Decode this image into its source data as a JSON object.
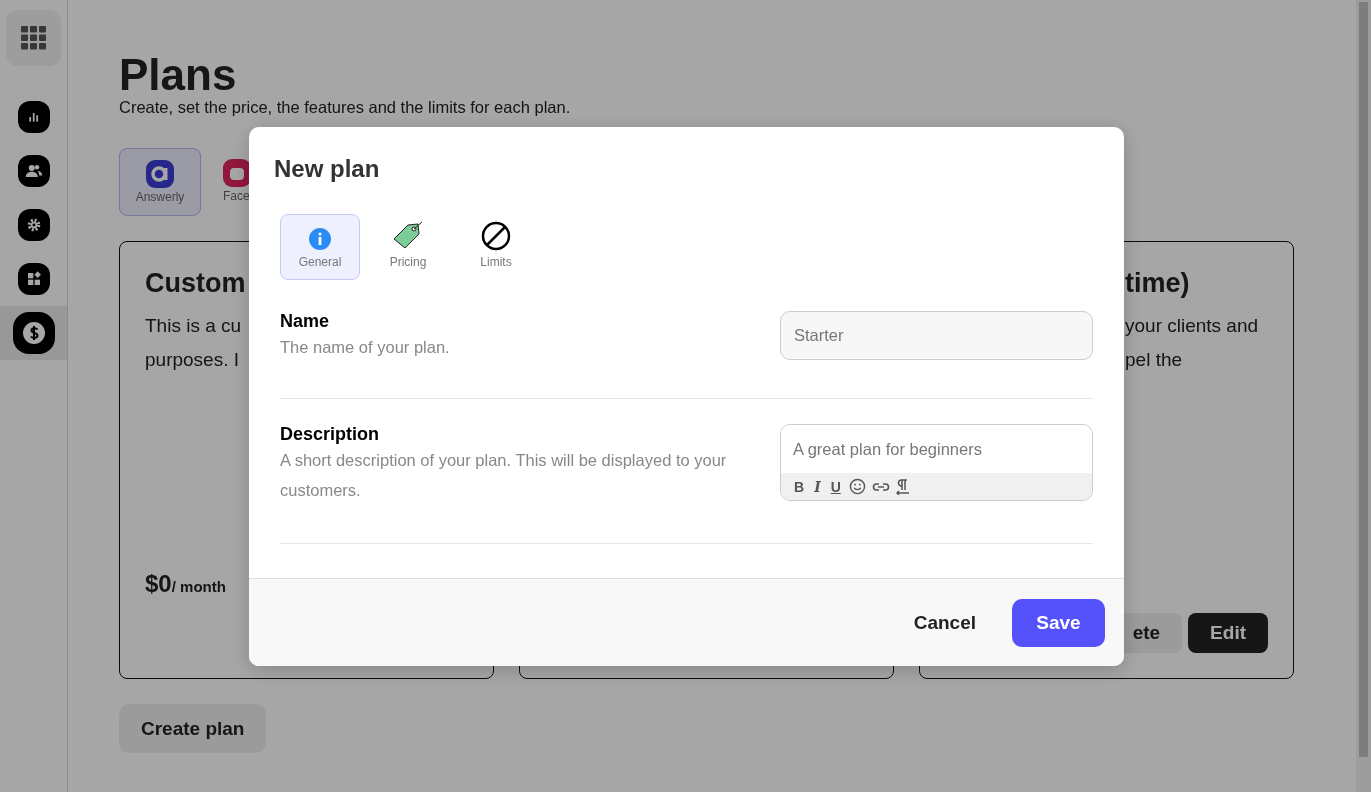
{
  "sidebar": {
    "items": [
      {
        "selected": false
      },
      {
        "selected": false
      },
      {
        "selected": false
      },
      {
        "selected": false
      },
      {
        "selected": true
      }
    ]
  },
  "page": {
    "title": "Plans",
    "subtitle": "Create, set the price, the features and the limits for each plan.",
    "apps": [
      {
        "label": "Answerly",
        "selected": true
      },
      {
        "label": "Face",
        "selected": false
      }
    ],
    "cards": [
      {
        "kind": "priced",
        "title": "Custom",
        "description_lines": [
          "This is a cu",
          "purposes. I"
        ],
        "price": "$0",
        "period": "/ month"
      },
      {
        "kind": "covered"
      },
      {
        "kind": "actions",
        "title": "time)",
        "description_lines": [
          "your clients and",
          "pel the"
        ],
        "buttons": [
          {
            "label": "ete",
            "kind": "secondary"
          },
          {
            "label": "Edit",
            "kind": "primary"
          }
        ]
      }
    ],
    "create_button": "Create plan"
  },
  "modal": {
    "title": "New plan",
    "tabs": [
      {
        "label": "General",
        "kind": "info",
        "selected": true
      },
      {
        "label": "Pricing",
        "kind": "tag",
        "selected": false
      },
      {
        "label": "Limits",
        "kind": "ban",
        "selected": false
      }
    ],
    "fields": [
      {
        "kind": "input",
        "label": "Name",
        "help": "The name of your plan.",
        "placeholder": "Starter"
      },
      {
        "kind": "editor",
        "label": "Description",
        "help": "A short description of your plan. This will be displayed to your customers.",
        "placeholder": "A great plan for beginners",
        "format_buttons": [
          {
            "kind": "bold",
            "label": "B"
          },
          {
            "kind": "italic",
            "label": "I"
          },
          {
            "kind": "underline",
            "label": "U"
          }
        ]
      }
    ],
    "cancel": "Cancel",
    "save": "Save"
  }
}
